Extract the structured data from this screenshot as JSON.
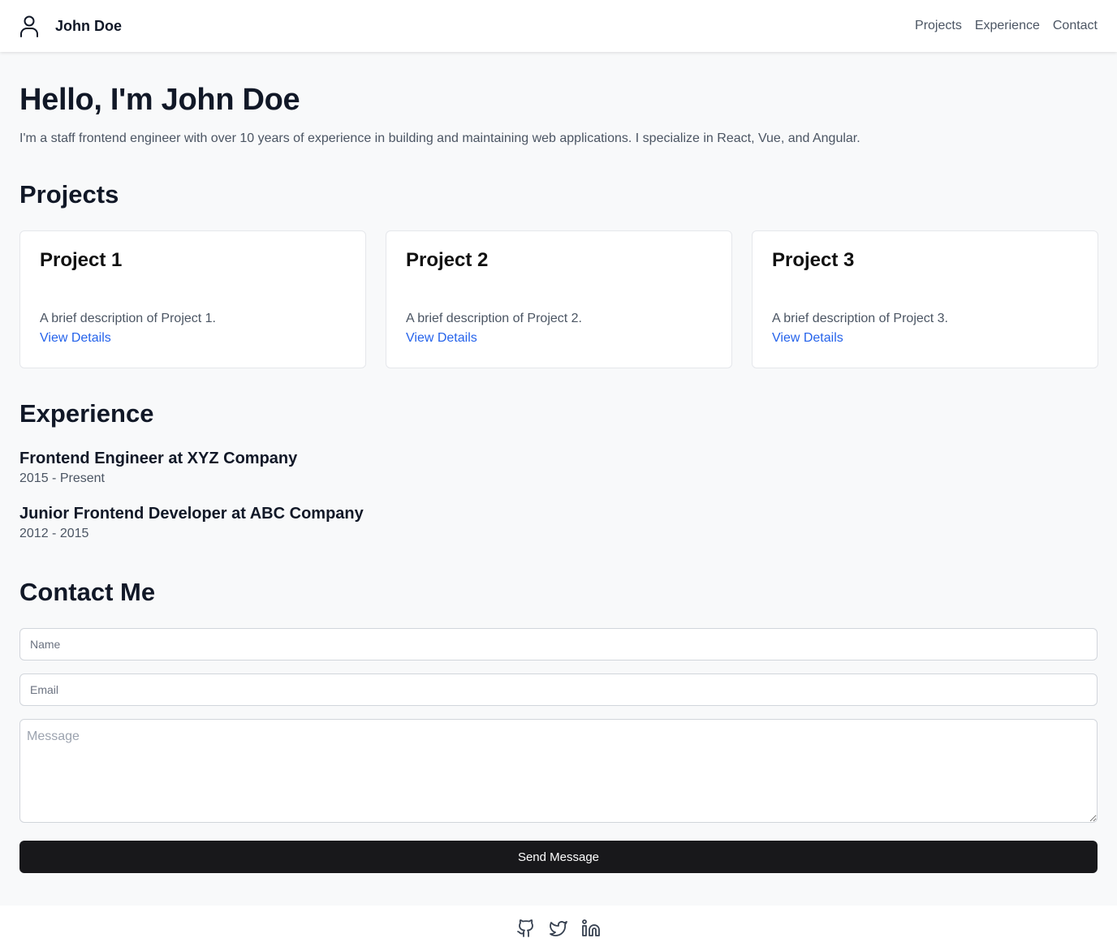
{
  "header": {
    "brand_name": "John Doe",
    "nav": [
      "Projects",
      "Experience",
      "Contact"
    ]
  },
  "hero": {
    "title": "Hello, I'm John Doe",
    "description": "I'm a staff frontend engineer with over 10 years of experience in building and maintaining web applications. I specialize in React, Vue, and Angular."
  },
  "projects": {
    "title": "Projects",
    "items": [
      {
        "title": "Project 1",
        "description": "A brief description of Project 1.",
        "link": "View Details"
      },
      {
        "title": "Project 2",
        "description": "A brief description of Project 2.",
        "link": "View Details"
      },
      {
        "title": "Project 3",
        "description": "A brief description of Project 3.",
        "link": "View Details"
      }
    ]
  },
  "experience": {
    "title": "Experience",
    "items": [
      {
        "role": "Frontend Engineer at XYZ Company",
        "dates": "2015 - Present"
      },
      {
        "role": "Junior Frontend Developer at ABC Company",
        "dates": "2012 - 2015"
      }
    ]
  },
  "contact": {
    "title": "Contact Me",
    "name_placeholder": "Name",
    "email_placeholder": "Email",
    "message_placeholder": "Message",
    "send_label": "Send Message"
  },
  "footer": {
    "icons": [
      "github-icon",
      "twitter-icon",
      "linkedin-icon"
    ]
  },
  "colors": {
    "link": "#2563eb",
    "button_bg": "#18181b",
    "page_bg": "#f8f9fa"
  }
}
